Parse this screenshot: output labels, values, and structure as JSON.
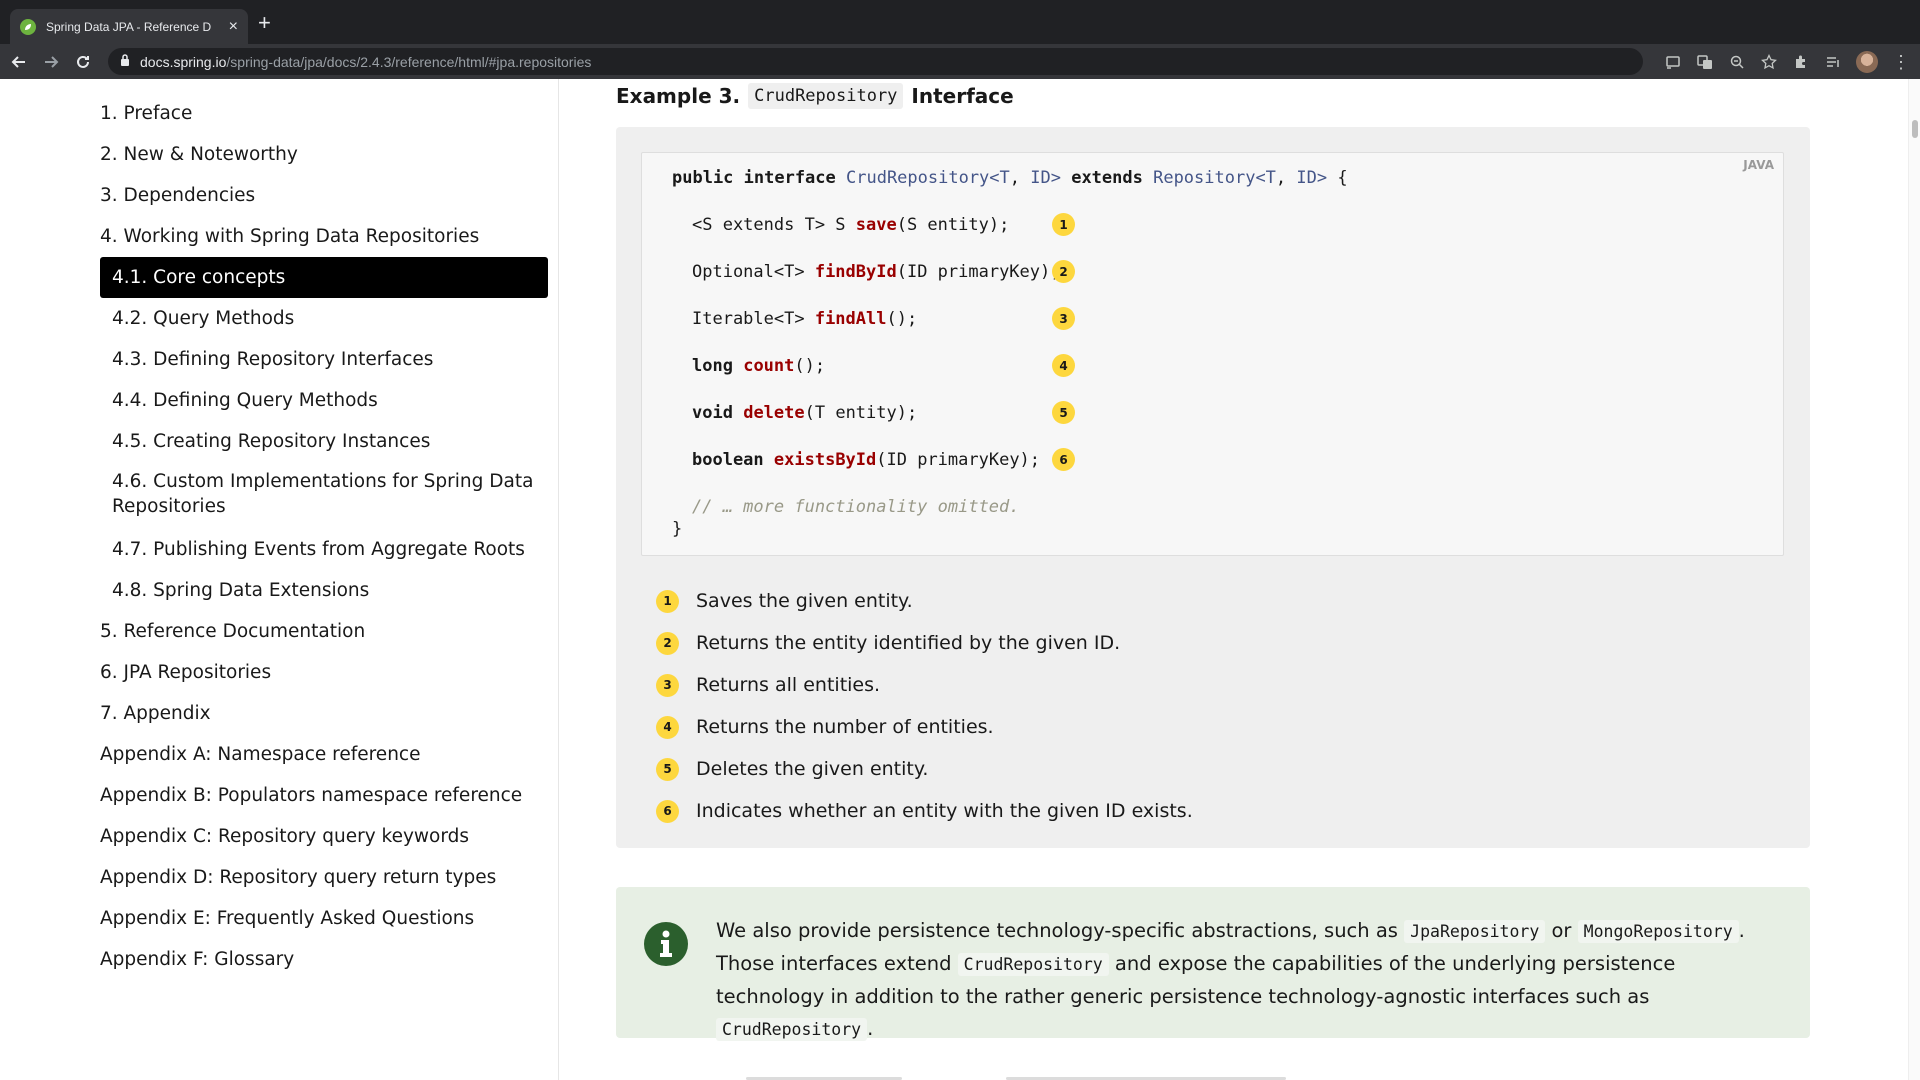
{
  "browser": {
    "tab_title": "Spring Data JPA - Reference D",
    "url_host": "docs.spring.io",
    "url_path": "/spring-data/jpa/docs/2.4.3/reference/html/#jpa.repositories"
  },
  "sidebar": {
    "items": [
      {
        "label": "1. Preface"
      },
      {
        "label": "2. New & Noteworthy"
      },
      {
        "label": "3. Dependencies"
      },
      {
        "label": "4. Working with Spring Data Repositories"
      },
      {
        "label": "4.1. Core concepts"
      },
      {
        "label": "4.2. Query Methods"
      },
      {
        "label": "4.3. Defining Repository Interfaces"
      },
      {
        "label": "4.4. Defining Query Methods"
      },
      {
        "label": "4.5. Creating Repository Instances"
      },
      {
        "label": "4.6. Custom Implementations for Spring Data Repositories"
      },
      {
        "label": "4.7. Publishing Events from Aggregate Roots"
      },
      {
        "label": "4.8. Spring Data Extensions"
      },
      {
        "label": "5. Reference Documentation"
      },
      {
        "label": "6. JPA Repositories"
      },
      {
        "label": "7. Appendix"
      },
      {
        "label": "Appendix A: Namespace reference"
      },
      {
        "label": "Appendix B: Populators namespace reference"
      },
      {
        "label": "Appendix C: Repository query keywords"
      },
      {
        "label": "Appendix D: Repository query return types"
      },
      {
        "label": "Appendix E: Frequently Asked Questions"
      },
      {
        "label": "Appendix F: Glossary"
      }
    ]
  },
  "example": {
    "prefix": "Example 3.",
    "code_name": "CrudRepository",
    "suffix": "Interface",
    "language": "JAVA",
    "code": {
      "l0": {
        "kw1": "public interface ",
        "ty1": "CrudRepository<T",
        "p1": ", ",
        "ty2": "ID>",
        "kw2": " extends ",
        "ty3": "Repository<T",
        "p2": ", ",
        "ty4": "ID>",
        "p3": " {"
      },
      "l1": {
        "pre": "<S extends T> S ",
        "fn": "save",
        "post": "(S entity);"
      },
      "l2": {
        "pre": "Optional<T> ",
        "fn": "findById",
        "post": "(ID primaryKey);"
      },
      "l3": {
        "pre": "Iterable<T> ",
        "fn": "findAll",
        "post": "();"
      },
      "l4": {
        "kw": "long",
        "sp": " ",
        "fn": "count",
        "post": "();"
      },
      "l5": {
        "kw": "void",
        "sp": " ",
        "fn": "delete",
        "post": "(T entity);"
      },
      "l6": {
        "kw": "boolean",
        "sp": " ",
        "fn": "existsById",
        "post": "(ID primaryKey);"
      },
      "comment": "// … more functionality omitted.",
      "close": "}"
    },
    "callouts": [
      {
        "num": "1",
        "text": "Saves the given entity."
      },
      {
        "num": "2",
        "text": "Returns the entity identified by the given ID."
      },
      {
        "num": "3",
        "text": "Returns all entities."
      },
      {
        "num": "4",
        "text": "Returns the number of entities."
      },
      {
        "num": "5",
        "text": "Deletes the given entity."
      },
      {
        "num": "6",
        "text": "Indicates whether an entity with the given ID exists."
      }
    ]
  },
  "note": {
    "t1": "We also provide persistence technology-specific abstractions, such as ",
    "c1": "JpaRepository",
    "t2": " or ",
    "c2": "MongoRepository",
    "t3": ". Those interfaces extend ",
    "c3": "CrudRepository",
    "t4": " and expose the capabilities of the underlying persistence technology in addition to the rather generic persistence technology-agnostic interfaces such as ",
    "c4": "CrudRepository",
    "t5": "."
  }
}
